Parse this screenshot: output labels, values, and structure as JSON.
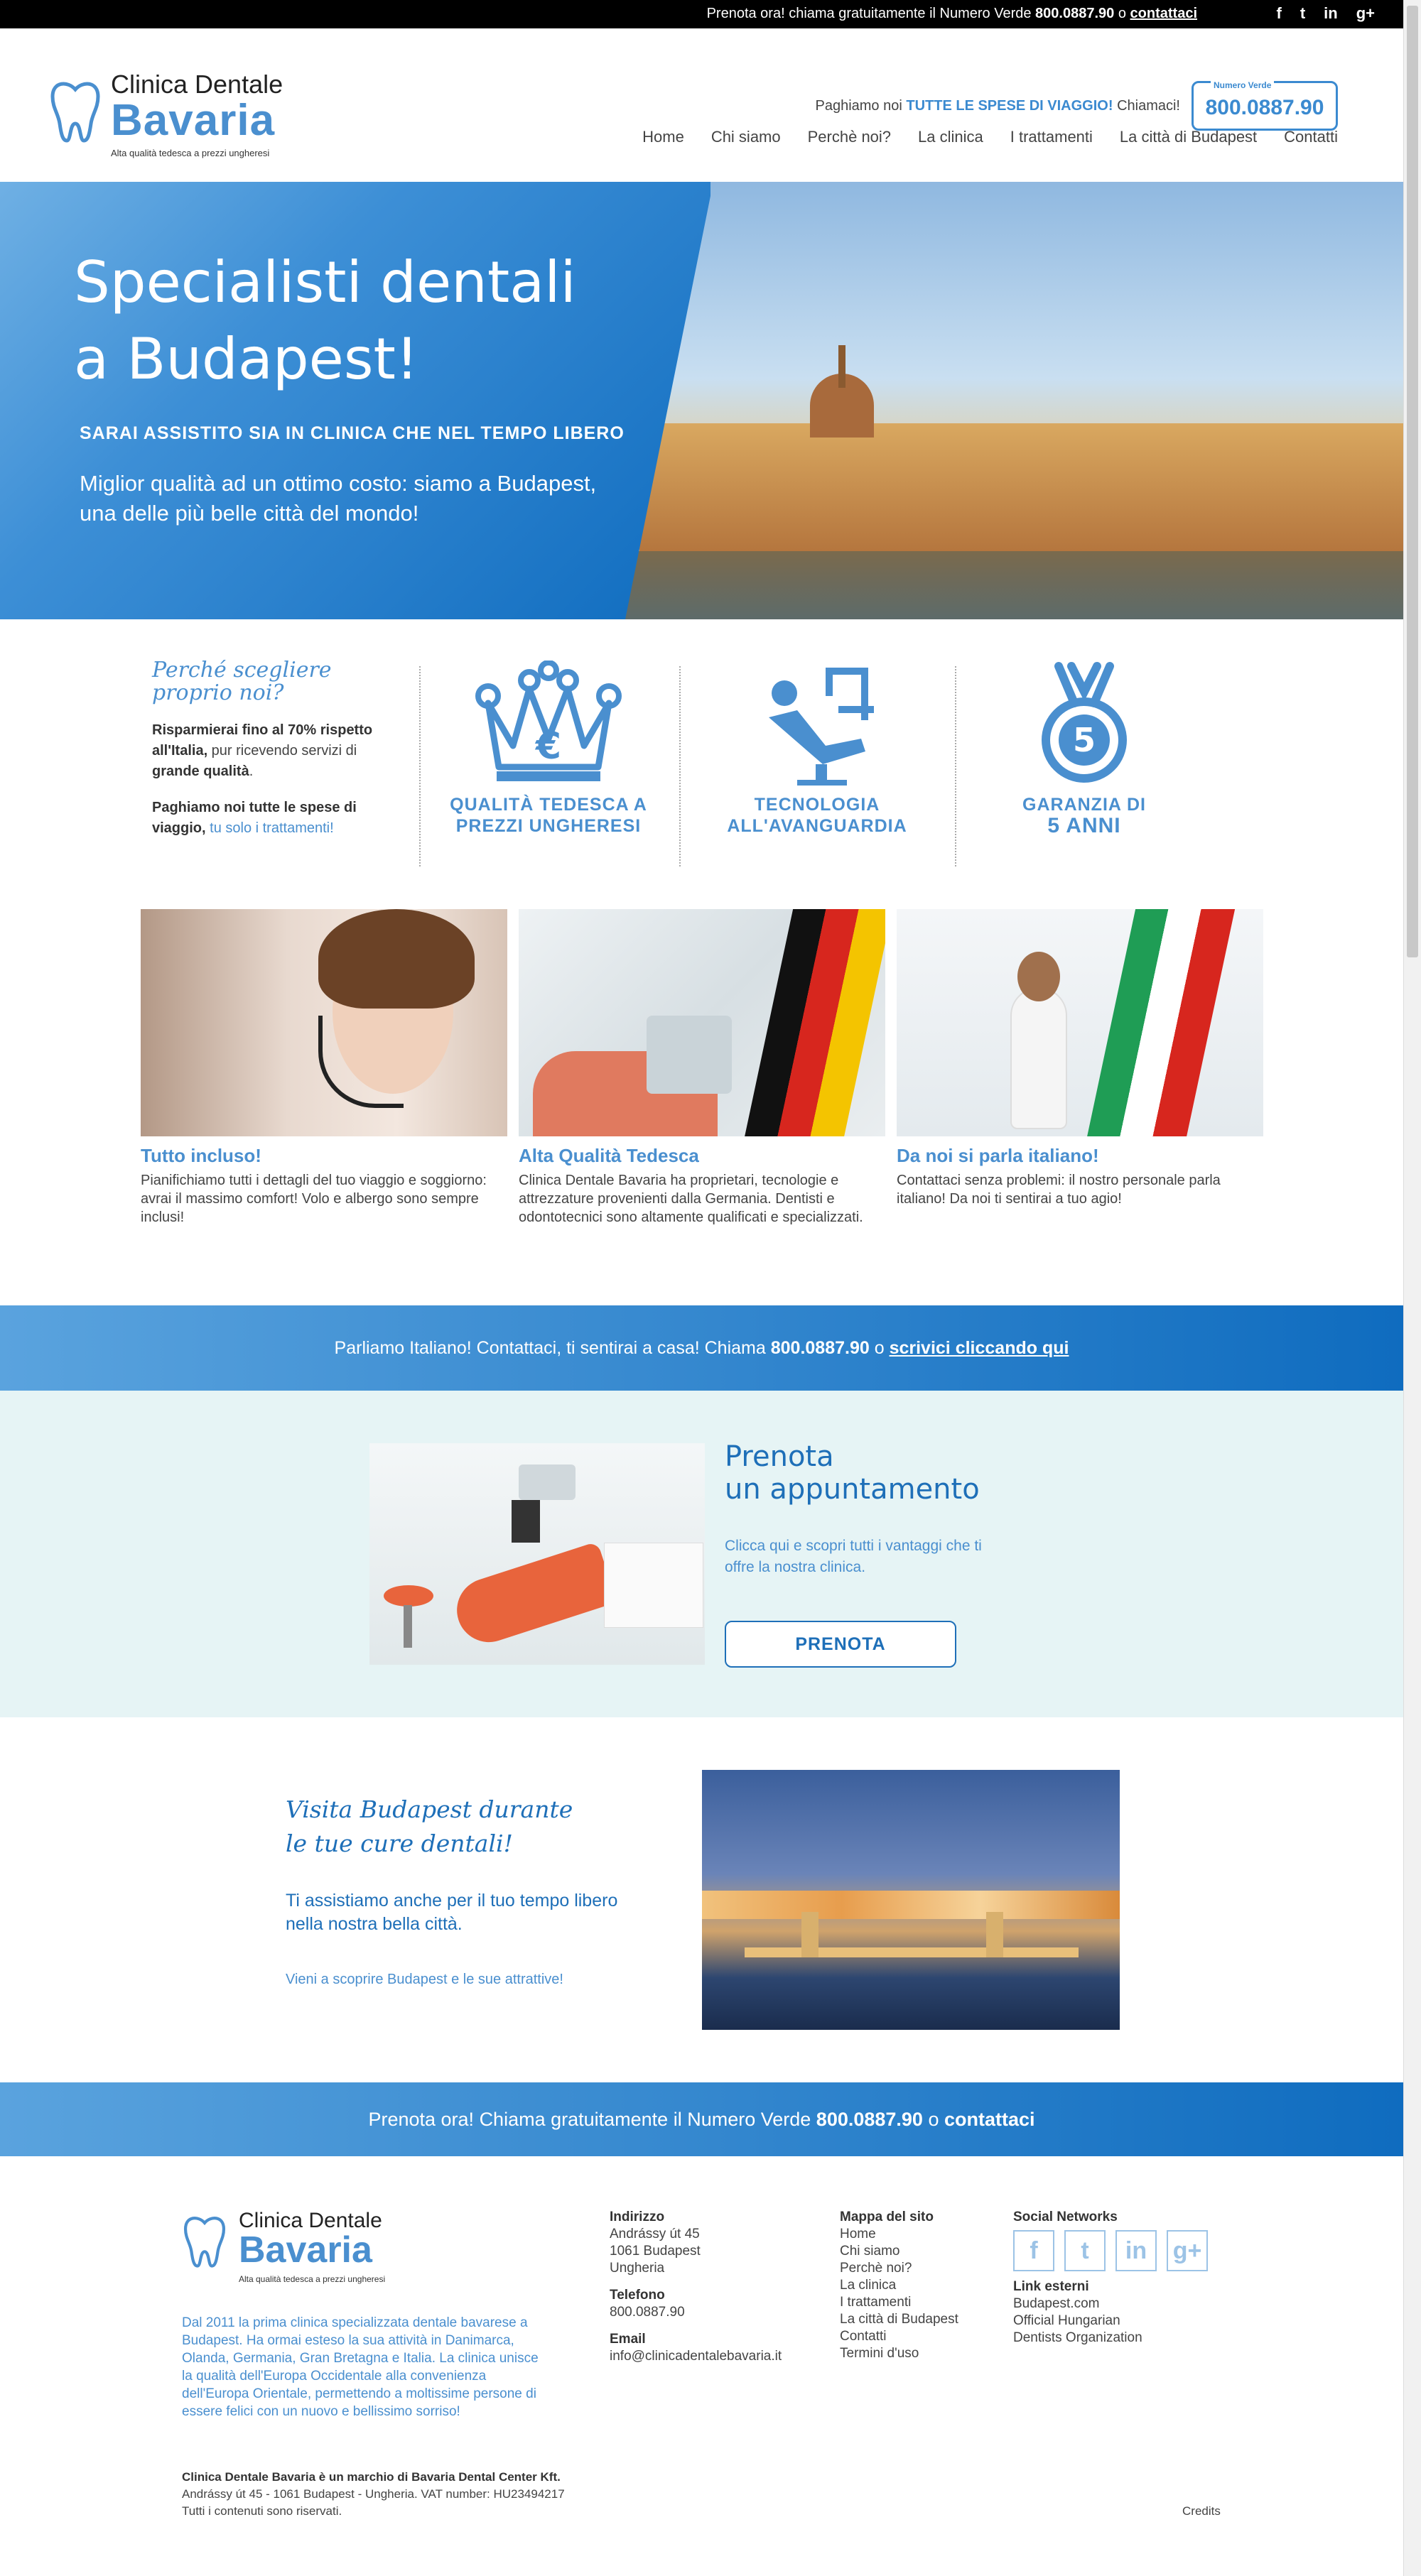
{
  "topbar": {
    "text_pre": "Prenota ora! chiama gratuitamente il Numero Verde ",
    "phone": "800.0887.90",
    "text_mid": " o ",
    "link": "contattaci",
    "social": {
      "facebook": "f",
      "twitter": "t",
      "linkedin": "in",
      "googleplus": "g+"
    }
  },
  "header": {
    "logo_line1": "Clinica Dentale",
    "logo_line2": "Bavaria",
    "logo_tagline": "Alta qualità tedesca a prezzi ungheresi",
    "tagline_pre": "Paghiamo noi ",
    "tagline_bold": "TUTTE LE SPESE DI VIAGGIO!",
    "tagline_post": " Chiamaci!",
    "phone_label": "Numero Verde",
    "phone_number": "800.0887.90",
    "nav": [
      "Home",
      "Chi siamo",
      "Perchè noi?",
      "La clinica",
      "I trattamenti",
      "La città di Budapest",
      "Contatti"
    ]
  },
  "hero": {
    "title_line1": "Specialisti dentali",
    "title_line2": "a Budapest!",
    "subtitle": "SARAI ASSISTITO SIA IN CLINICA CHE NEL TEMPO LIBERO",
    "desc_line1": "Miglior qualità ad un ottimo costo: siamo a Budapest,",
    "desc_line2": "una delle più belle città del mondo!"
  },
  "why": {
    "title_line1": "Perché scegliere",
    "title_line2": "proprio noi?",
    "p1_b1": "Risparmierai fino al 70% rispetto all'Italia,",
    "p1_t1": " pur ricevendo servizi di ",
    "p1_b2": "grande qualità",
    "p1_t2": ".",
    "p2_b": "Paghiamo noi tutte le spese di viaggio,",
    "p2_t": " tu solo i trattamenti!"
  },
  "features": [
    {
      "line1": "QUALITÀ TEDESCA A",
      "line2": "PREZZI UNGHERESI"
    },
    {
      "line1": "TECNOLOGIA",
      "line2": "ALL'AVANGUARDIA"
    },
    {
      "line1": "GARANZIA DI",
      "line2": "5 ANNI"
    }
  ],
  "cards": [
    {
      "title": "Tutto incluso!",
      "text": "Pianifichiamo tutti i dettagli del tuo viaggio e soggiorno: avrai il massimo comfort! Volo e albergo sono sempre inclusi!"
    },
    {
      "title": "Alta Qualità Tedesca",
      "text": "Clinica Dentale Bavaria ha proprietari, tecnologie e attrezzature provenienti dalla Germania. Dentisti e odontotecnici sono altamente qualificati e specializzati."
    },
    {
      "title": "Da noi si parla italiano!",
      "text": "Contattaci senza problemi: il nostro personale parla italiano! Da noi ti sentirai a tuo agio!"
    }
  ],
  "band1": {
    "text": "Parliamo Italiano! Contattaci, ti sentirai a casa! Chiama ",
    "phone": "800.0887.90",
    "mid": " o ",
    "link": "scrivici cliccando qui"
  },
  "appointment": {
    "title_line1": "Prenota",
    "title_line2": "un appuntamento",
    "text": "Clicca qui e scopri tutti i vantaggi che ti offre la nostra clinica.",
    "button": "PRENOTA"
  },
  "visit": {
    "title_line1": "Visita Budapest durante",
    "title_line2": "le tue cure dentali!",
    "text_line1": "Ti assistiamo anche per il tuo tempo libero",
    "text_line2": "nella nostra bella città.",
    "link": "Vieni a scoprire Budapest e le sue attrattive!"
  },
  "band2": {
    "text": "Prenota ora! Chiama gratuitamente il Numero Verde ",
    "phone": "800.0887.90",
    "mid": " o ",
    "link": "contattaci"
  },
  "footer": {
    "about": "Dal 2011 la prima clinica specializzata dentale bavarese a Budapest. Ha ormai esteso la sua attività in Danimarca, Olanda, Germania, Gran Bretagna e Italia. La clinica unisce la qualità dell'Europa Occidentale alla convenienza dell'Europa Orientale, permettendo a moltissime persone di essere felici con un nuovo e bellissimo sorriso!",
    "address_title": "Indirizzo",
    "address_lines": [
      "Andrássy út 45",
      "1061 Budapest",
      "Ungheria"
    ],
    "phone_title": "Telefono",
    "phone": "800.0887.90",
    "email_title": "Email",
    "email": "info@clinicadentalebavaria.it",
    "sitemap_title": "Mappa del sito",
    "sitemap": [
      "Home",
      "Chi siamo",
      "Perchè noi?",
      "La clinica",
      "I trattamenti",
      "La città di Budapest",
      "Contatti",
      "Termini d'uso"
    ],
    "social_title": "Social Networks",
    "social": {
      "facebook": "f",
      "twitter": "t",
      "linkedin": "in",
      "googleplus": "g+"
    },
    "ext_title": "Link esterni",
    "ext_links": [
      "Budapest.com",
      "Official Hungarian",
      "Dentists Organization"
    ],
    "legal_bold": "Clinica Dentale Bavaria è un marchio di Bavaria Dental Center Kft.",
    "legal_line2": "Andrássy út 45 - 1061 Budapest - Ungheria. VAT number: HU23494217",
    "legal_line3": "Tutti i contenuti sono riservati.",
    "credits": "Credits"
  },
  "colors": {
    "accent": "#4a8fcf",
    "dark_blue": "#0f6cbf",
    "band_light": "#e6f4f5"
  }
}
